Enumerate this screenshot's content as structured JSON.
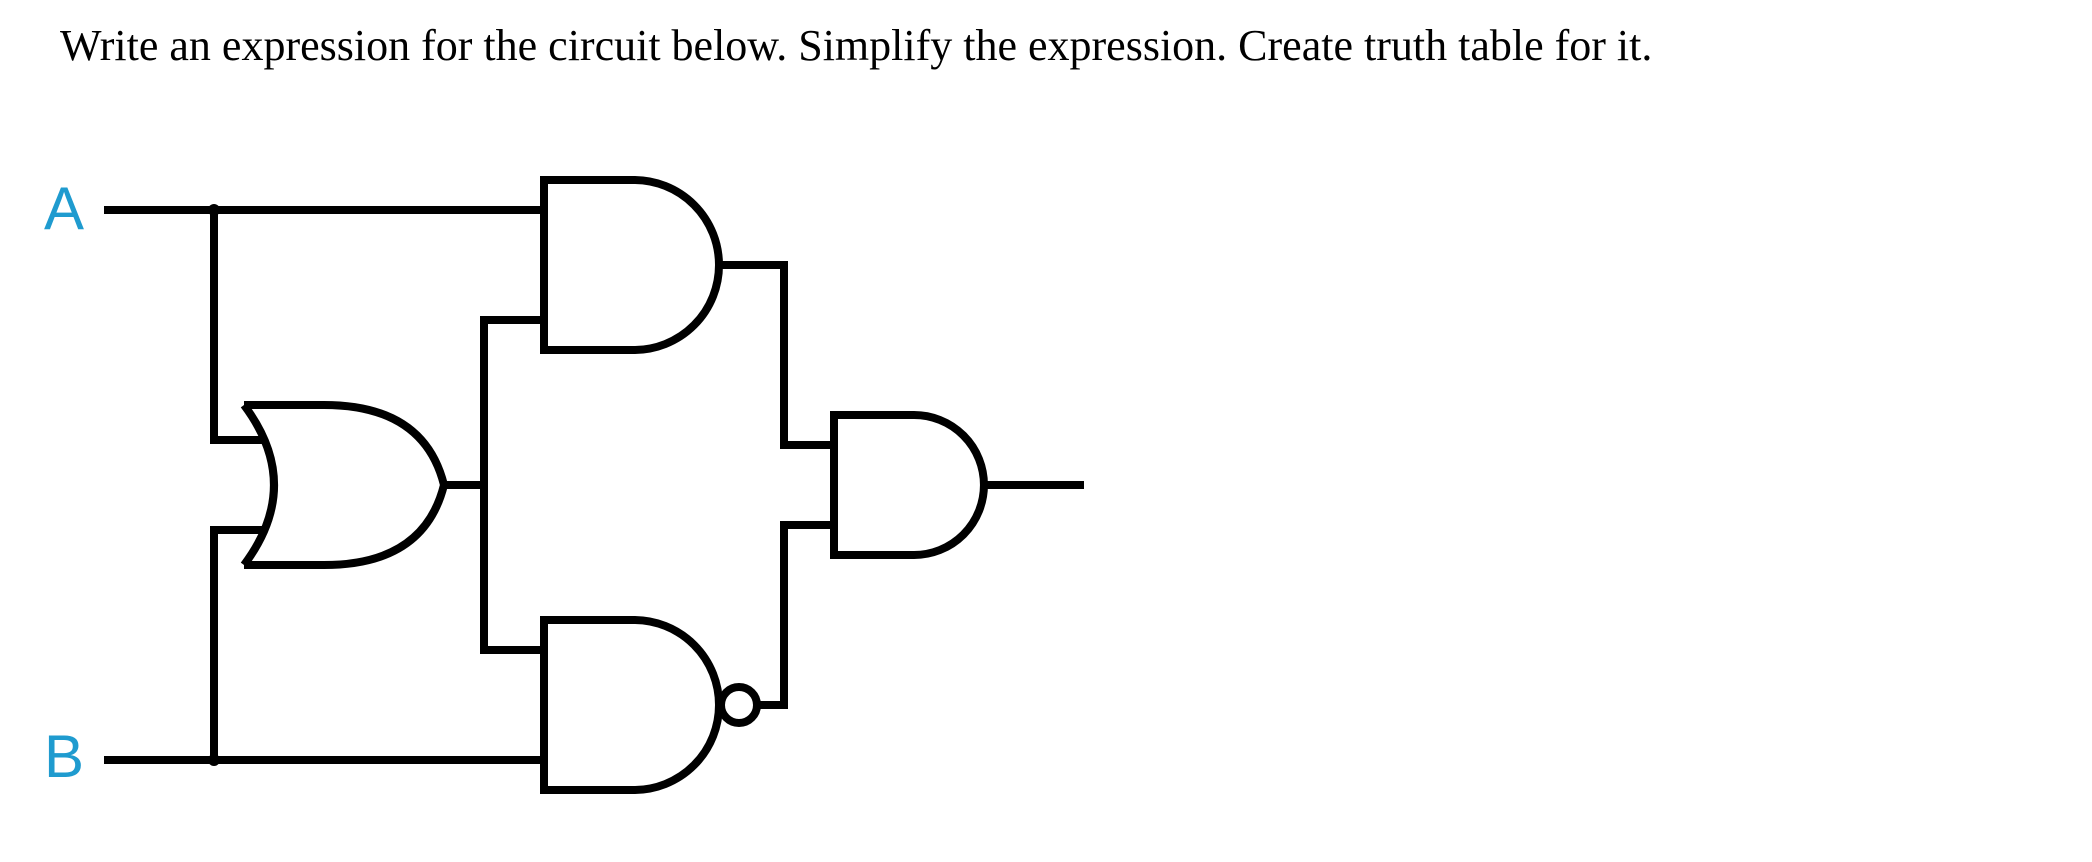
{
  "question": "Write an expression for the circuit below. Simplify the expression. Create truth table for it.",
  "inputs": {
    "a": "A",
    "b": "B"
  },
  "gates": {
    "g1": {
      "type": "OR",
      "inputs": [
        "A",
        "B"
      ],
      "symbol_desc": "2-input OR gate"
    },
    "g2": {
      "type": "AND",
      "inputs": [
        "A",
        "g1"
      ],
      "symbol_desc": "2-input AND gate"
    },
    "g3": {
      "type": "NAND",
      "inputs": [
        "g1",
        "B"
      ],
      "symbol_desc": "2-input NAND gate (AND with output bubble)"
    },
    "g4": {
      "type": "AND",
      "inputs": [
        "g2",
        "g3"
      ],
      "symbol_desc": "2-input AND gate (final output)"
    }
  },
  "output": "g4",
  "expression_raw": "(A · (A + B)) · ((A + B) · B)'",
  "colors": {
    "line": "#000000",
    "label": "#1f9bcf",
    "question": "#000000",
    "background": "#ffffff"
  }
}
